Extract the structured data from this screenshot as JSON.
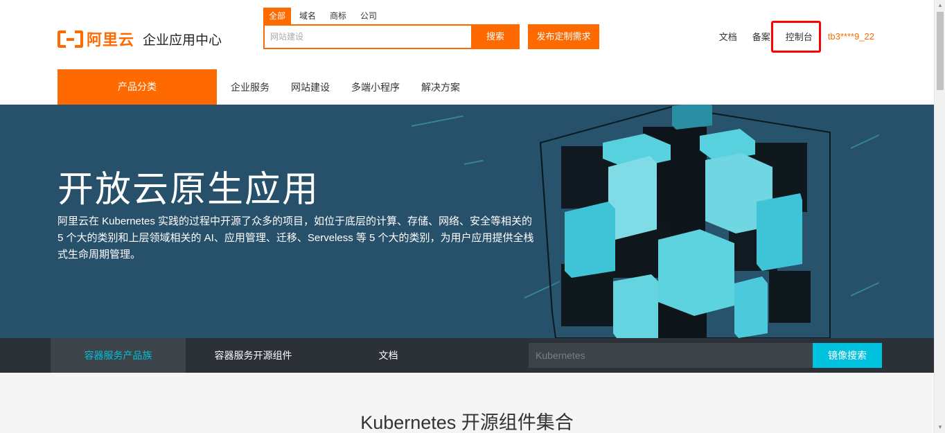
{
  "header": {
    "logo_text": "阿里云",
    "logo_sub": "企业应用中心",
    "search_tabs": [
      "全部",
      "域名",
      "商标",
      "公司"
    ],
    "search_placeholder": "网站建设",
    "search_button": "搜索",
    "publish_button": "发布定制需求",
    "links": {
      "docs": "文档",
      "filing": "备案",
      "console": "控制台",
      "user": "tb3****9_22"
    }
  },
  "nav": {
    "category": "产品分类",
    "items": [
      "企业服务",
      "网站建设",
      "多端小程序",
      "解决方案"
    ]
  },
  "banner": {
    "title": "开放云原生应用",
    "description": "阿里云在 Kubernetes 实践的过程中开源了众多的项目，如位于底层的计算、存储、网络、安全等相关的 5 个大的类别和上层领域相关的 AI、应用管理、迁移、Serveless 等 5 个大的类别，为用户应用提供全栈式生命周期管理。"
  },
  "subnav": {
    "tabs": [
      "容器服务产品族",
      "容器服务开源组件",
      "文档"
    ],
    "search_placeholder": "Kubernetes",
    "search_button": "镜像搜索"
  },
  "main": {
    "section_title": "Kubernetes 开源组件集合"
  },
  "colors": {
    "brand": "#ff6a00",
    "banner_bg": "#27506a",
    "accent": "#00c1de",
    "highlight": "#ff0000"
  }
}
